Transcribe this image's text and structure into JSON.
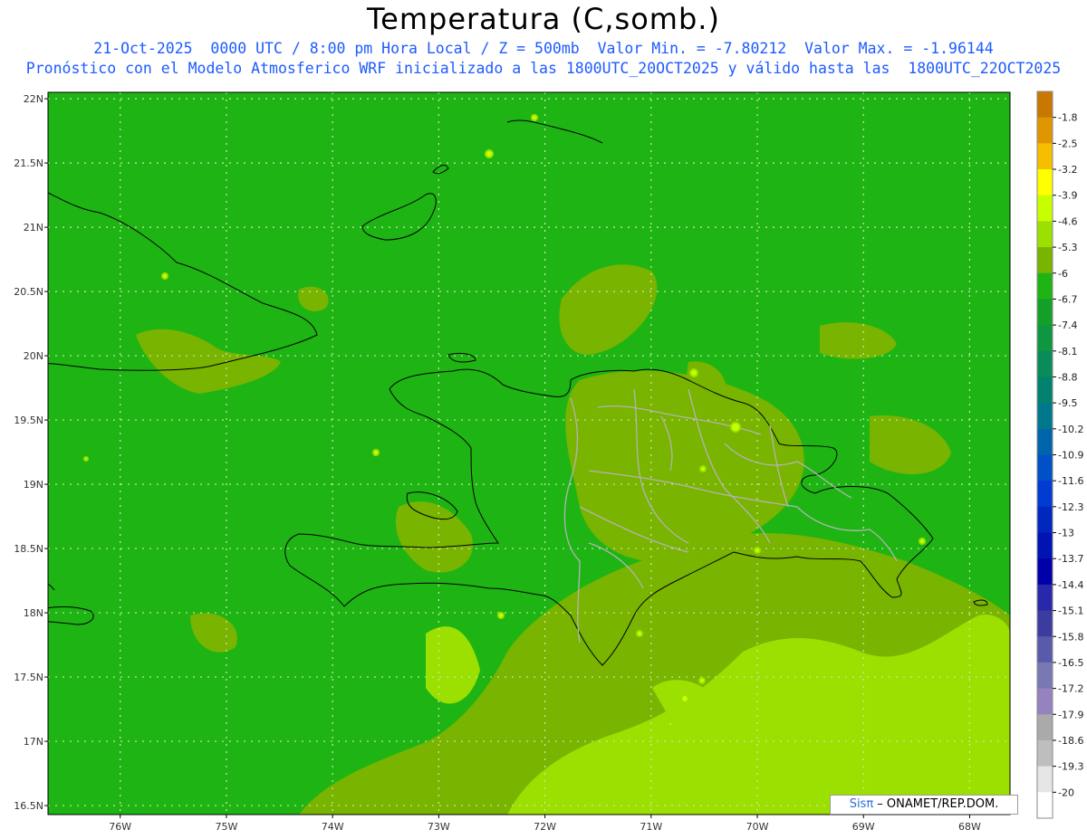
{
  "title": "Temperatura (C,somb.)",
  "subtitle1": "21-Oct-2025  0000 UTC / 8:00 pm Hora Local / Z = 500mb  Valor Min. = -7.80212  Valor Max. = -1.96144",
  "subtitle2": "Pronóstico con el Modelo Atmosferico WRF inicializado a las 1800UTC_20OCT2025 y válido hasta las  1800UTC_22OCT2025",
  "credit": {
    "logo": "Sisπ",
    "text": " – ONAMET/REP.DOM."
  },
  "axes": {
    "lat_labels": [
      "22N",
      "21.5N",
      "21N",
      "20.5N",
      "20N",
      "19.5N",
      "19N",
      "18.5N",
      "18N",
      "17.5N",
      "17N",
      "16.5N"
    ],
    "lat_values": [
      22,
      21.5,
      21,
      20.5,
      20,
      19.5,
      19,
      18.5,
      18,
      17.5,
      17,
      16.5
    ],
    "lon_labels": [
      "76W",
      "75W",
      "74W",
      "73W",
      "72W",
      "71W",
      "70W",
      "69W",
      "68W"
    ],
    "lon_values": [
      -76,
      -75,
      -74,
      -73,
      -72,
      -71,
      -70,
      -69,
      -68
    ],
    "lat_range": [
      16.43,
      22.05
    ],
    "lon_range": [
      -76.68,
      -67.62
    ]
  },
  "colorbar": {
    "labels": [
      "-1.8",
      "-2.5",
      "-3.2",
      "-3.9",
      "-4.6",
      "-5.3",
      "-6",
      "-6.7",
      "-7.4",
      "-8.1",
      "-8.8",
      "-9.5",
      "-10.2",
      "-10.9",
      "-11.6",
      "-12.3",
      "-13",
      "-13.7",
      "-14.4",
      "-15.1",
      "-15.8",
      "-16.5",
      "-17.2",
      "-17.9",
      "-18.6",
      "-19.3",
      "-20"
    ],
    "colors": [
      "#c87800",
      "#e09600",
      "#f5be00",
      "#ffff00",
      "#c8ff00",
      "#9be000",
      "#78b400",
      "#1eb414",
      "#14a028",
      "#0f9641",
      "#0a8c5a",
      "#00826e",
      "#00788c",
      "#0064aa",
      "#0050c8",
      "#003cd2",
      "#0028be",
      "#0014b4",
      "#0000aa",
      "#2828aa",
      "#3c3ca0",
      "#5a5aaa",
      "#7878b4",
      "#9682be",
      "#aaaaaa",
      "#bebebe",
      "#e6e6e6",
      "#ffffff"
    ]
  },
  "field": {
    "base_color": "#1eb414",
    "warm_color": "#78b400",
    "warmer_color": "#9be000"
  }
}
